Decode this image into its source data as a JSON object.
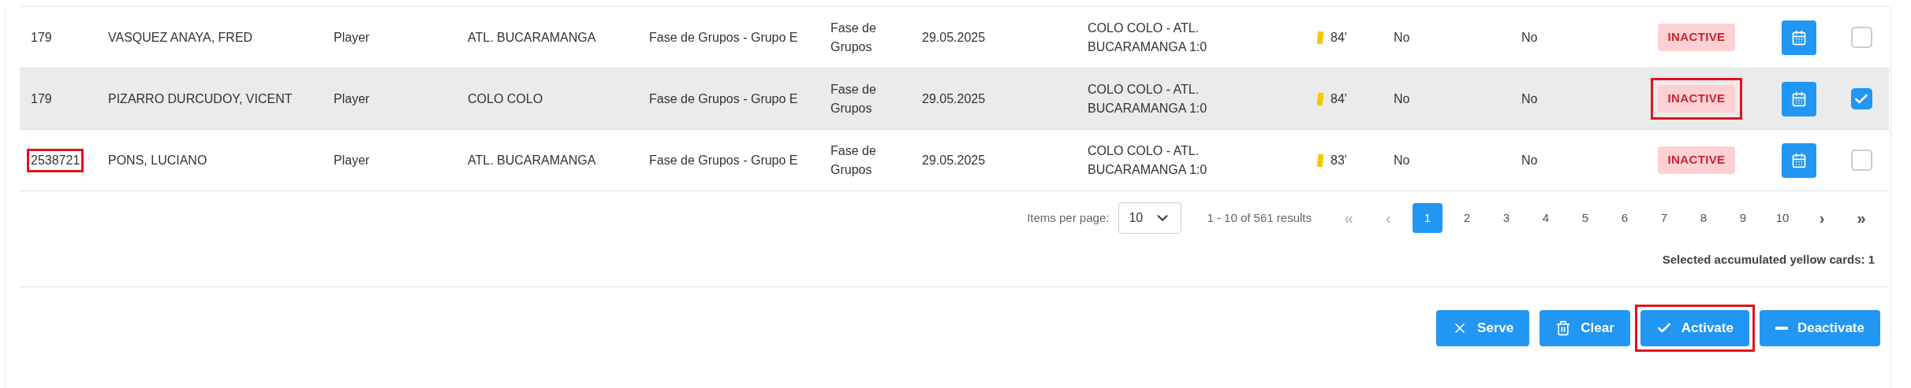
{
  "table": {
    "rows": [
      {
        "id": "179",
        "name": "VASQUEZ ANAYA, FRED",
        "role": "Player",
        "club": "ATL. BUCARAMANGA",
        "phase": "Fase de Grupos - Grupo E",
        "stage": "Fase de Grupos",
        "date": "29.05.2025",
        "match": "COLO COLO - ATL. BUCARAMANGA 1:0",
        "minute": "84'",
        "column_10": "No",
        "column_11": "No",
        "status": "INACTIVE",
        "selected": false,
        "id_highlighted": false,
        "status_highlighted": false
      },
      {
        "id": "179",
        "name": "PIZARRO DURCUDOY, VICENT",
        "role": "Player",
        "club": "COLO COLO",
        "phase": "Fase de Grupos - Grupo E",
        "stage": "Fase de Grupos",
        "date": "29.05.2025",
        "match": "COLO COLO - ATL. BUCARAMANGA 1:0",
        "minute": "84'",
        "column_10": "No",
        "column_11": "No",
        "status": "INACTIVE",
        "selected": true,
        "id_highlighted": false,
        "status_highlighted": true
      },
      {
        "id": "2538721",
        "name": "PONS, LUCIANO",
        "role": "Player",
        "club": "ATL. BUCARAMANGA",
        "phase": "Fase de Grupos - Grupo E",
        "stage": "Fase de Grupos",
        "date": "29.05.2025",
        "match": "COLO COLO - ATL. BUCARAMANGA 1:0",
        "minute": "83'",
        "column_10": "No",
        "column_11": "No",
        "status": "INACTIVE",
        "selected": false,
        "id_highlighted": true,
        "status_highlighted": false
      }
    ]
  },
  "pagination": {
    "items_per_page_label": "Items per page:",
    "items_per_page": "10",
    "range": "1 - 10 of 561 results",
    "first": "«",
    "prev": "‹",
    "next": "›",
    "last": "»",
    "pages": [
      {
        "label": "1",
        "selected": true
      },
      {
        "label": "2",
        "selected": false
      },
      {
        "label": "3",
        "selected": false
      },
      {
        "label": "4",
        "selected": false
      },
      {
        "label": "5",
        "selected": false
      },
      {
        "label": "6",
        "selected": false
      },
      {
        "label": "7",
        "selected": false
      },
      {
        "label": "8",
        "selected": false
      },
      {
        "label": "9",
        "selected": false
      },
      {
        "label": "10",
        "selected": false
      }
    ]
  },
  "summary": "Selected accumulated yellow cards: 1",
  "actions": [
    {
      "kind": "serve",
      "label": "Serve",
      "highlighted": false
    },
    {
      "kind": "clear",
      "label": "Clear",
      "highlighted": false
    },
    {
      "kind": "activate",
      "label": "Activate",
      "highlighted": true
    },
    {
      "kind": "deactivate",
      "label": "Deactivate",
      "highlighted": false
    }
  ]
}
